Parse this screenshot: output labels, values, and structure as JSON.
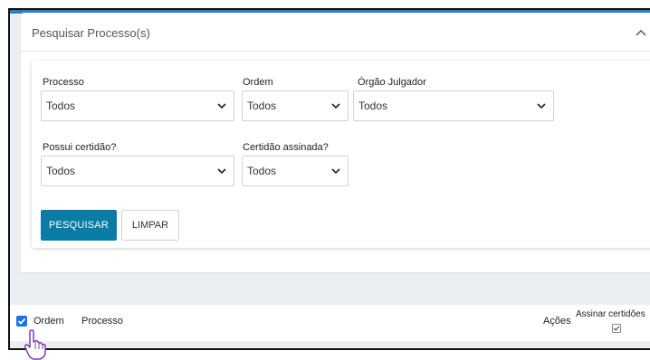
{
  "panel": {
    "title": "Pesquisar Processo(s)"
  },
  "form": {
    "processo": {
      "label": "Processo",
      "value": "Todos"
    },
    "ordem": {
      "label": "Ordem",
      "value": "Todos"
    },
    "orgao": {
      "label": "Órgão Julgador",
      "value": "Todos"
    },
    "possui": {
      "label": "Possui certidão?",
      "value": "Todos"
    },
    "assinada": {
      "label": "Certidão assinada?",
      "value": "Todos"
    },
    "pesquisar_label": "PESQUISAR",
    "limpar_label": "LIMPAR"
  },
  "table": {
    "col_ordem": "Ordem",
    "col_processo": "Processo",
    "col_acoes": "Ações",
    "col_assinar": "Assinar certidões",
    "select_all_checked": true
  },
  "colors": {
    "primary": "#0b7ca6",
    "accent": "#2d7fc1",
    "checkbox": "#1a73e8"
  },
  "icons": {
    "collapse": "chevron-up-icon",
    "dropdown": "chevron-down-icon",
    "pointer": "hand-cursor-icon"
  }
}
